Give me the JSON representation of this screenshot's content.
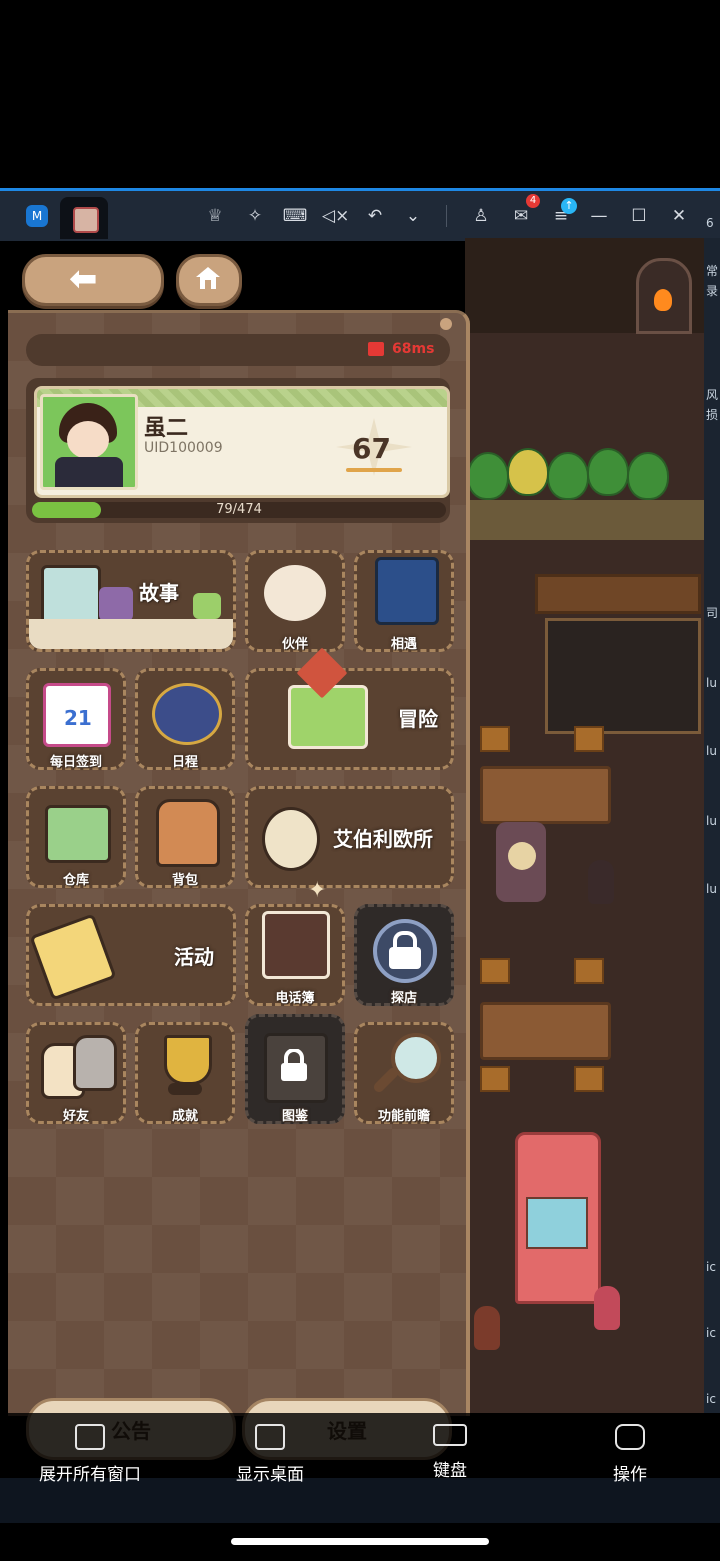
{
  "toolbar": {
    "app_logo": "M",
    "mail_badge": "4",
    "update_badge": "↑",
    "icons": [
      "crown-icon",
      "pin-icon",
      "keyboard-icon",
      "mute-icon",
      "undo-icon",
      "chevron-down-icon",
      "user-icon",
      "mail-icon",
      "menu-icon",
      "minimize-icon",
      "maximize-icon",
      "close-icon"
    ]
  },
  "side_strip": [
    "6",
    "常",
    "录",
    "风",
    "损",
    "司",
    "lu",
    "lu",
    "lu",
    "lu",
    "ic",
    "ic",
    "ic"
  ],
  "status": {
    "ping": "68ms"
  },
  "profile": {
    "name": "虽二",
    "uid": "UID100009",
    "level": "67",
    "xp_text": "79/474",
    "xp_fraction": 0.167
  },
  "menu": {
    "story": "故事",
    "partner": "伙伴",
    "encounter": "相遇",
    "daily_signin": "每日签到",
    "schedule": "日程",
    "adventure": "冒险",
    "warehouse": "仓库",
    "backpack": "背包",
    "abel_office": "艾伯利欧所",
    "activity": "活动",
    "phonebook": "电话簿",
    "shop": "探店",
    "friends": "好友",
    "achievements": "成就",
    "collection": "图鉴",
    "feature_preview": "功能前瞻",
    "calendar_day": "21"
  },
  "bottom": {
    "notice": "公告",
    "settings": "设置"
  },
  "nav": {
    "expand_windows": "展开所有窗口",
    "show_desktop": "显示桌面",
    "keyboard": "键盘",
    "operate": "操作"
  },
  "colors": {
    "panel": "#6a5040",
    "xp_green": "#7ac142",
    "ping_red": "#e53935",
    "accent_blue": "#1e88e5"
  }
}
